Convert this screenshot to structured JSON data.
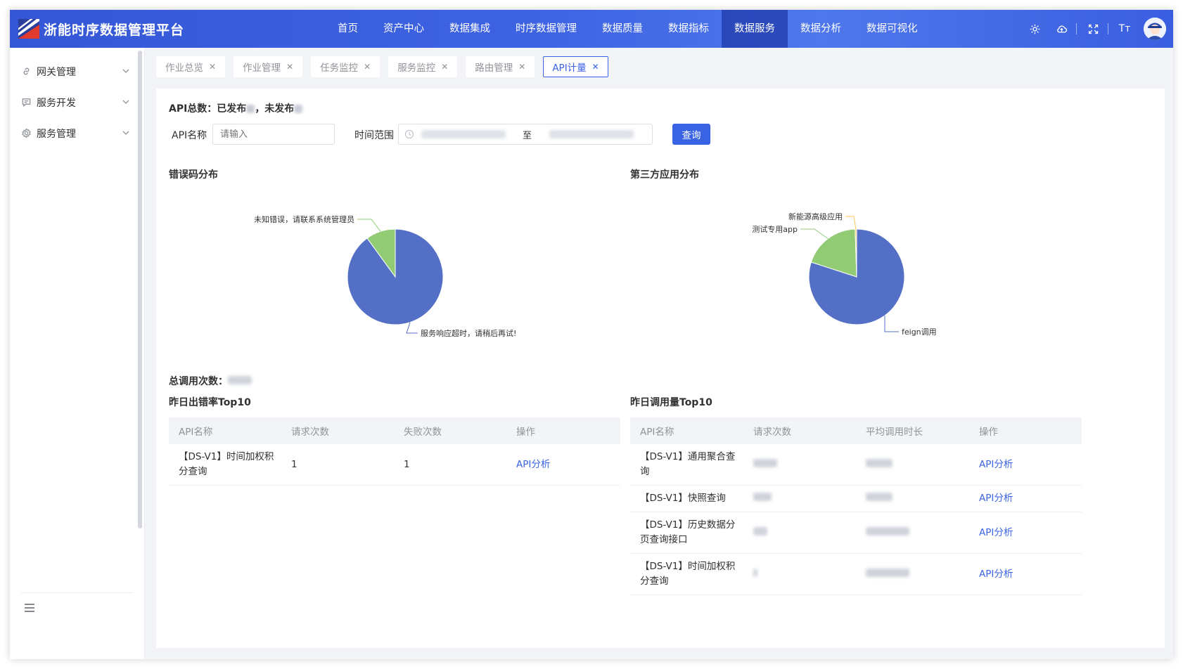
{
  "header": {
    "title": "浙能时序数据管理平台",
    "nav": [
      "首页",
      "资产中心",
      "数据集成",
      "时序数据管理",
      "数据质量",
      "数据指标",
      "数据服务",
      "数据分析",
      "数据可视化"
    ],
    "active_nav": 6,
    "tools": [
      "gear-icon",
      "cloud-icon",
      "fullscreen-icon",
      "font-size-icon"
    ],
    "font_tool_label": "Tт"
  },
  "sidebar": {
    "items": [
      {
        "label": "网关管理",
        "icon": "link-icon"
      },
      {
        "label": "服务开发",
        "icon": "comment-icon"
      },
      {
        "label": "服务管理",
        "icon": "gear-icon"
      }
    ]
  },
  "tabs": [
    {
      "label": "作业总览"
    },
    {
      "label": "作业管理"
    },
    {
      "label": "任务监控"
    },
    {
      "label": "服务监控"
    },
    {
      "label": "路由管理"
    },
    {
      "label": "API计量",
      "active": true
    }
  ],
  "content": {
    "summary": {
      "prefix": "API总数：已发布",
      "mid": "，未发布"
    },
    "filters": {
      "api_name_label": "API名称",
      "api_name_placeholder": "请输入",
      "time_range_label": "时间范围",
      "range_sep": "至",
      "query_label": "查询"
    },
    "error_chart_title": "错误码分布",
    "app_chart_title": "第三方应用分布",
    "total_calls_label": "总调用次数：",
    "error_top_title": "昨日出错率Top10",
    "usage_top_title": "昨日调用量Top10",
    "error_table": {
      "headers": [
        "API名称",
        "请求次数",
        "失败次数",
        "操作"
      ],
      "rows": [
        {
          "name": "【DS-V1】时间加权积分查询",
          "requests": "1",
          "failures": "1",
          "action": "API分析"
        }
      ]
    },
    "usage_table": {
      "headers": [
        "API名称",
        "请求次数",
        "平均调用时长",
        "操作"
      ],
      "rows": [
        {
          "name": "【DS-V1】通用聚合查询",
          "action": "API分析"
        },
        {
          "name": "【DS-V1】快照查询",
          "action": "API分析"
        },
        {
          "name": "【DS-V1】历史数据分页查询接口",
          "action": "API分析"
        },
        {
          "name": "【DS-V1】时间加权积分查询",
          "action": "API分析"
        }
      ]
    }
  },
  "chart_data": [
    {
      "type": "pie",
      "title": "错误码分布",
      "labels": [
        "服务响应超时，请稍后再试!",
        "未知错误，请联系系统管理员"
      ],
      "values": [
        90,
        10
      ],
      "colors": [
        "#5470c6",
        "#91cc75"
      ]
    },
    {
      "type": "pie",
      "title": "第三方应用分布",
      "labels": [
        "feign调用",
        "测试专用app",
        "新能源高级应用"
      ],
      "values": [
        80,
        19.5,
        0.5
      ],
      "colors": [
        "#5470c6",
        "#91cc75",
        "#fac858"
      ]
    }
  ]
}
